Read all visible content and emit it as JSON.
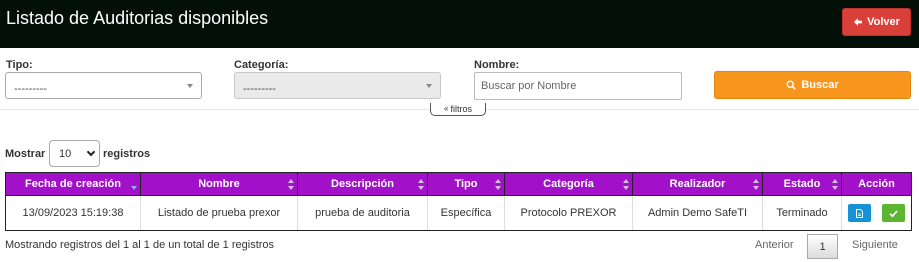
{
  "header": {
    "title": "Listado de Auditorias disponibles",
    "back_label": "Volver"
  },
  "filters": {
    "tipo_label": "Tipo:",
    "tipo_value": "---------",
    "categoria_label": "Categoría:",
    "categoria_value": "---------",
    "nombre_label": "Nombre:",
    "nombre_placeholder": "Buscar por Nombre",
    "nombre_value": "",
    "search_label": "Buscar",
    "toggle_label": "filtros"
  },
  "length_menu": {
    "prefix": "Mostrar",
    "value": "10",
    "suffix": "registros"
  },
  "table": {
    "columns": [
      "Fecha de creación",
      "Nombre",
      "Descripción",
      "Tipo",
      "Categoría",
      "Realizador",
      "Estado",
      "Acción"
    ],
    "rows": [
      [
        "13/09/2023 15:19:38",
        "Listado de prueba prexor",
        "prueba de auditoria",
        "Específica",
        "Protocolo PREXOR",
        "Admin Demo SafeTI",
        "Terminado"
      ]
    ]
  },
  "footer": {
    "info": "Mostrando registros del 1 al 1 de un total de 1 registros",
    "prev": "Anterior",
    "page": "1",
    "next": "Siguiente"
  },
  "colors": {
    "header_bg": "#031008",
    "back_button": "#d9403a",
    "search_button": "#f7951d",
    "table_header": "#a210c9",
    "action_blue": "#1591d6",
    "action_green": "#5cb531"
  }
}
